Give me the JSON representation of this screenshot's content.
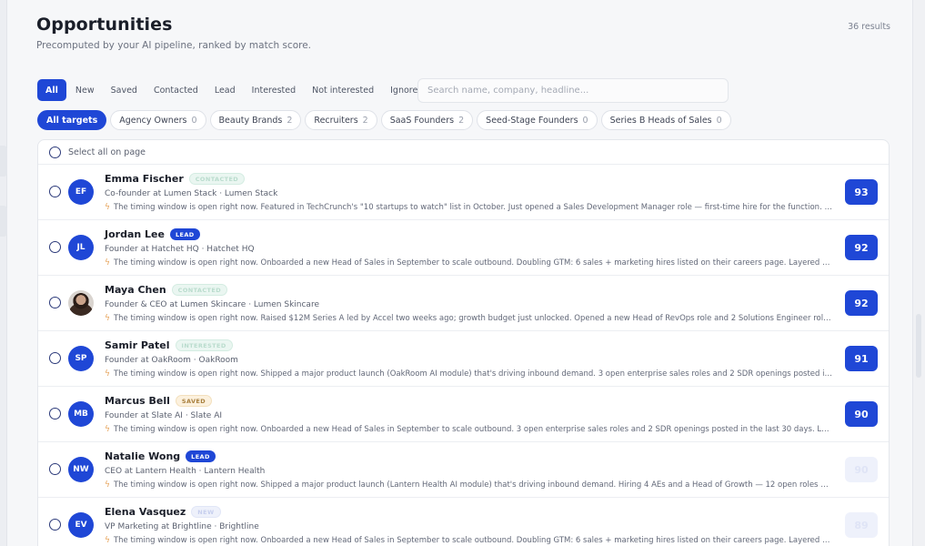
{
  "header": {
    "title": "Opportunities",
    "subtitle": "Precomputed by your AI pipeline, ranked by match score.",
    "results_count": "36 results"
  },
  "status_tabs": [
    {
      "label": "All",
      "active": true
    },
    {
      "label": "New",
      "active": false
    },
    {
      "label": "Saved",
      "active": false
    },
    {
      "label": "Contacted",
      "active": false
    },
    {
      "label": "Lead",
      "active": false
    },
    {
      "label": "Interested",
      "active": false
    },
    {
      "label": "Not interested",
      "active": false
    },
    {
      "label": "Ignored",
      "active": false
    }
  ],
  "search": {
    "placeholder": "Search name, company, headline...",
    "value": ""
  },
  "target_chips": [
    {
      "label": "All targets",
      "count": "",
      "active": true
    },
    {
      "label": "Agency Owners",
      "count": "0",
      "active": false
    },
    {
      "label": "Beauty Brands",
      "count": "2",
      "active": false
    },
    {
      "label": "Recruiters",
      "count": "2",
      "active": false
    },
    {
      "label": "SaaS Founders",
      "count": "2",
      "active": false
    },
    {
      "label": "Seed-Stage Founders",
      "count": "0",
      "active": false
    },
    {
      "label": "Series B Heads of Sales",
      "count": "0",
      "active": false
    }
  ],
  "list": {
    "select_all_label": "Select all on page",
    "rows": [
      {
        "initials": "EF",
        "avatar_icon": "",
        "name": "Emma Fischer",
        "badge": "CONTACTED",
        "badge_style": "faded-green",
        "title": "Co-founder at Lumen Stack · Lumen Stack",
        "signal": "The timing window is open right now. Featured in TechCrunch's \"10 startups to watch\" list in October. Just opened a Sales Development Manager role — first-time hire for the function. La...",
        "score": "93",
        "score_faded": false
      },
      {
        "initials": "JL",
        "avatar_icon": "",
        "name": "Jordan Lee",
        "badge": "LEAD",
        "badge_style": "lead",
        "title": "Founder at Hatchet HQ · Hatchet HQ",
        "signal": "The timing window is open right now. Onboarded a new Head of Sales in September to scale outbound. Doubling GTM: 6 sales + marketing hires listed on their careers page. Layered tog...",
        "score": "92",
        "score_faded": false
      },
      {
        "initials": "",
        "avatar_icon": "user-photo",
        "name": "Maya Chen",
        "badge": "CONTACTED",
        "badge_style": "faded-green",
        "title": "Founder & CEO at Lumen Skincare · Lumen Skincare",
        "signal": "The timing window is open right now. Raised $12M Series A led by Accel two weeks ago; growth budget just unlocked. Opened a new Head of RevOps role and 2 Solutions Engineer roles t...",
        "score": "92",
        "score_faded": false
      },
      {
        "initials": "SP",
        "avatar_icon": "",
        "name": "Samir Patel",
        "badge": "INTERESTED",
        "badge_style": "faded-green",
        "title": "Founder at OakRoom · OakRoom",
        "signal": "The timing window is open right now. Shipped a major product launch (OakRoom AI module) that's driving inbound demand. 3 open enterprise sales roles and 2 SDR openings posted in t...",
        "score": "91",
        "score_faded": false
      },
      {
        "initials": "MB",
        "avatar_icon": "",
        "name": "Marcus Bell",
        "badge": "SAVED",
        "badge_style": "saved",
        "title": "Founder at Slate AI · Slate AI",
        "signal": "The timing window is open right now. Onboarded a new Head of Sales in September to scale outbound. 3 open enterprise sales roles and 2 SDR openings posted in the last 30 days. Lay...",
        "score": "90",
        "score_faded": false
      },
      {
        "initials": "NW",
        "avatar_icon": "",
        "name": "Natalie Wong",
        "badge": "LEAD",
        "badge_style": "lead",
        "title": "CEO at Lantern Health · Lantern Health",
        "signal": "The timing window is open right now. Shipped a major product launch (Lantern Health AI module) that's driving inbound demand. Hiring 4 AEs and a Head of Growth — 12 open roles acro...",
        "score": "90",
        "score_faded": true
      },
      {
        "initials": "EV",
        "avatar_icon": "",
        "name": "Elena Vasquez",
        "badge": "NEW",
        "badge_style": "faded-blue",
        "title": "VP Marketing at Brightline · Brightline",
        "signal": "The timing window is open right now. Onboarded a new Head of Sales in September to scale outbound. Doubling GTM: 6 sales + marketing hires listed on their careers page. Layered tog...",
        "score": "89",
        "score_faded": true
      }
    ]
  },
  "colors": {
    "accent": "#1f47d6",
    "saved_badge_bg": "#fcf1de",
    "bolt": "#e6a35a"
  }
}
